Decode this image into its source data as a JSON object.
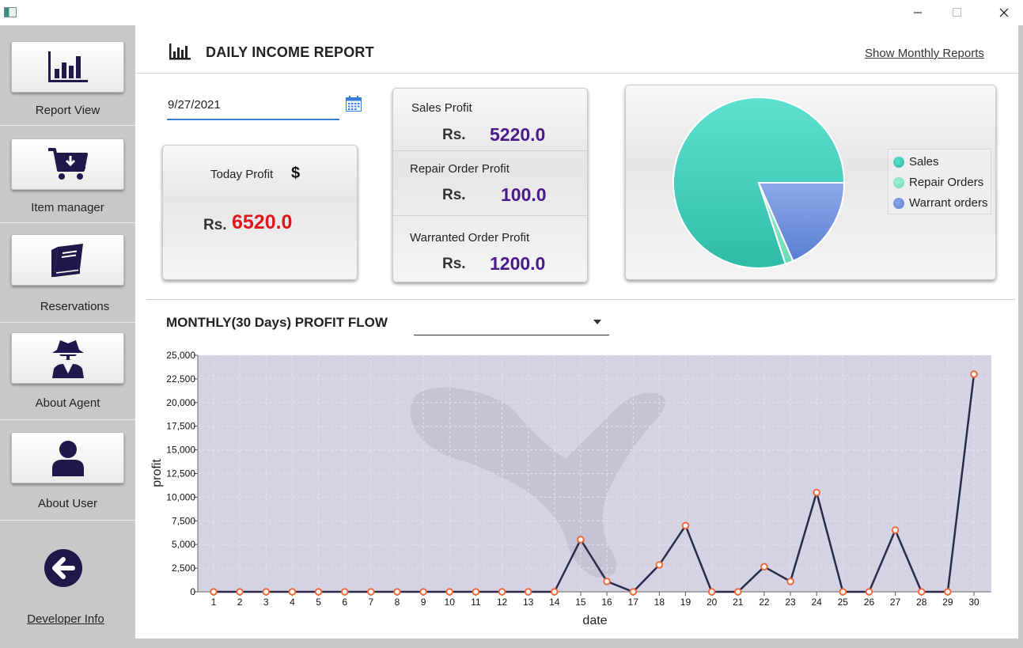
{
  "window": {
    "minimize_icon": "minimize-icon",
    "maximize_icon": "maximize-icon",
    "close_icon": "close-icon"
  },
  "sidebar": {
    "items": [
      {
        "label": "Report View",
        "icon": "bar-chart-icon"
      },
      {
        "label": "Item manager",
        "icon": "shopping-cart-icon"
      },
      {
        "label": "Reservations",
        "icon": "book-icon"
      },
      {
        "label": "About Agent",
        "icon": "spy-agent-icon"
      },
      {
        "label": "About User",
        "icon": "user-icon"
      }
    ],
    "back_icon": "arrow-left-icon",
    "developer_link": "Developer Info"
  },
  "header": {
    "title": "DAILY INCOME REPORT",
    "link": "Show Monthly Reports",
    "icon": "bar-chart-icon"
  },
  "date_picker": {
    "value": "9/27/2021",
    "icon": "calendar-icon"
  },
  "today_profit": {
    "label": "Today Profit",
    "currency_symbol": "$",
    "prefix": "Rs.",
    "value": "6520.0"
  },
  "profits": [
    {
      "label": "Sales Profit",
      "prefix": "Rs.",
      "value": "5220.0"
    },
    {
      "label": "Repair Order Profit",
      "prefix": "Rs.",
      "value": "100.0"
    },
    {
      "label": "Warranted Order Profit",
      "prefix": "Rs.",
      "value": "1200.0"
    }
  ],
  "pie": {
    "legend": [
      "Sales",
      "Repair Orders",
      "Warrant orders"
    ],
    "colors": [
      "#3ecbb8",
      "#7de8c6",
      "#6a8ddc"
    ],
    "values": [
      5220.0,
      100.0,
      1200.0
    ]
  },
  "monthly": {
    "title": "MONTHLY(30 Days) PROFIT FLOW",
    "select_value": ""
  },
  "colors": {
    "accent": "#3a7bd5",
    "value_purple": "#4a1a8a",
    "value_red": "#e0161e",
    "line": "#2b2a4a",
    "point": "#f06a3a"
  },
  "chart_data": {
    "type": "line",
    "xlabel": "date",
    "ylabel": "profit",
    "x": [
      1,
      2,
      3,
      4,
      5,
      6,
      7,
      8,
      9,
      10,
      11,
      12,
      13,
      14,
      15,
      16,
      17,
      18,
      19,
      20,
      21,
      22,
      23,
      24,
      25,
      26,
      27,
      28,
      29,
      30
    ],
    "y": [
      0,
      0,
      0,
      0,
      0,
      0,
      0,
      0,
      0,
      0,
      0,
      0,
      0,
      0,
      5520,
      1100,
      0,
      2850,
      7000,
      0,
      0,
      2650,
      1100,
      10500,
      0,
      0,
      6520,
      0,
      0,
      23000
    ],
    "ylim": [
      0,
      25000
    ],
    "yticks": [
      0,
      2500,
      5000,
      7500,
      10000,
      12500,
      15000,
      17500,
      20000,
      22500,
      25000
    ],
    "yticklabels": [
      "0",
      "2,500",
      "5,000",
      "7,500",
      "10,000",
      "12,500",
      "15,000",
      "17,500",
      "20,000",
      "22,500",
      "25,000"
    ],
    "grid": true
  }
}
